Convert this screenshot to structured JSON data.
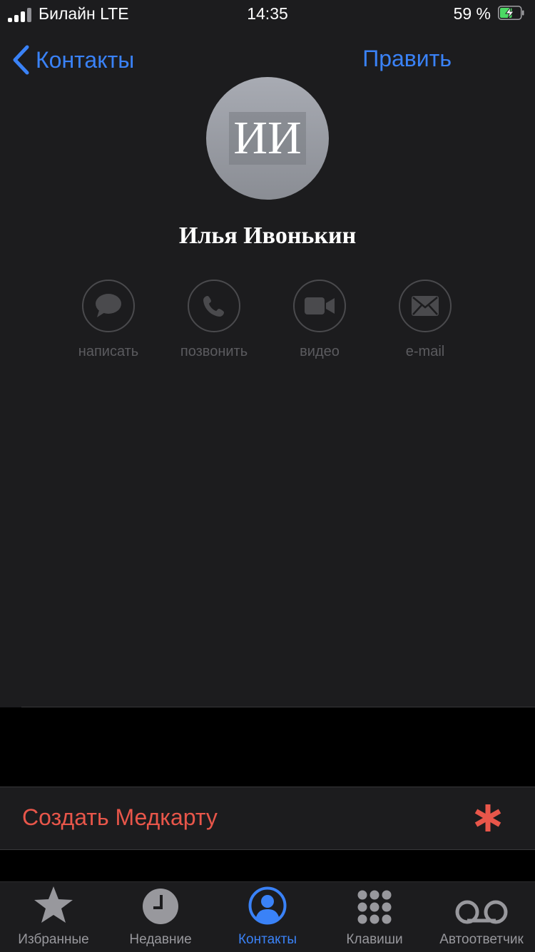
{
  "status_bar": {
    "carrier": "Билайн  LTE",
    "time": "14:35",
    "battery_percent": "59 %",
    "battery_level": 0.59,
    "signal_bars": 4
  },
  "nav": {
    "back_label": "Контакты",
    "edit_label": "Править"
  },
  "contact": {
    "initials": "ИИ",
    "name": "Илья Ивонькин"
  },
  "actions": [
    {
      "label": "написать",
      "icon": "message-icon"
    },
    {
      "label": "позвонить",
      "icon": "phone-icon"
    },
    {
      "label": "видео",
      "icon": "video-icon"
    },
    {
      "label": "e-mail",
      "icon": "mail-icon"
    }
  ],
  "medcard": {
    "label": "Создать Медкарту",
    "icon": "medical-asterisk-icon"
  },
  "tabbar": {
    "tabs": [
      {
        "label": "Избранные",
        "icon": "star-icon",
        "active": false
      },
      {
        "label": "Недавние",
        "icon": "clock-icon",
        "active": false
      },
      {
        "label": "Контакты",
        "icon": "person-circle-icon",
        "active": true
      },
      {
        "label": "Клавиши",
        "icon": "keypad-icon",
        "active": false
      },
      {
        "label": "Автоответчик",
        "icon": "voicemail-icon",
        "active": false
      }
    ]
  },
  "colors": {
    "accent": "#3a82f7",
    "destructive": "#e8564a",
    "background": "#1c1c1e",
    "inactive": "#98989d"
  }
}
